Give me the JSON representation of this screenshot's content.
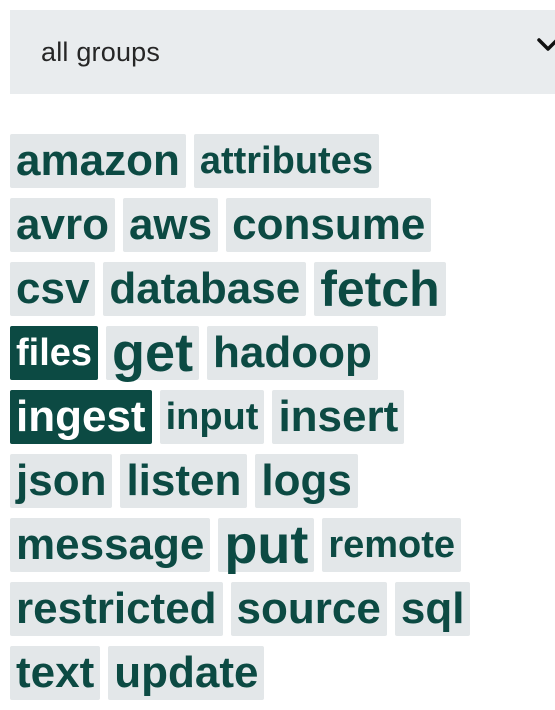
{
  "filter": {
    "selected_group": "all groups"
  },
  "icons": {
    "dropdown": "chevron-down-icon"
  },
  "colors": {
    "tag_background": "#e3e7e9",
    "tag_text": "#0c4a43",
    "selected_background": "#0c4a43",
    "selected_text": "#ffffff",
    "select_background": "#e9ecee"
  },
  "tags": [
    {
      "label": "amazon",
      "selected": false
    },
    {
      "label": "attributes",
      "selected": false
    },
    {
      "label": "avro",
      "selected": false
    },
    {
      "label": "aws",
      "selected": false
    },
    {
      "label": "consume",
      "selected": false
    },
    {
      "label": "csv",
      "selected": false
    },
    {
      "label": "database",
      "selected": false
    },
    {
      "label": "fetch",
      "selected": false
    },
    {
      "label": "files",
      "selected": true
    },
    {
      "label": "get",
      "selected": false
    },
    {
      "label": "hadoop",
      "selected": false
    },
    {
      "label": "ingest",
      "selected": true
    },
    {
      "label": "input",
      "selected": false
    },
    {
      "label": "insert",
      "selected": false
    },
    {
      "label": "json",
      "selected": false
    },
    {
      "label": "listen",
      "selected": false
    },
    {
      "label": "logs",
      "selected": false
    },
    {
      "label": "message",
      "selected": false
    },
    {
      "label": "put",
      "selected": false
    },
    {
      "label": "remote",
      "selected": false
    },
    {
      "label": "restricted",
      "selected": false
    },
    {
      "label": "source",
      "selected": false
    },
    {
      "label": "sql",
      "selected": false
    },
    {
      "label": "text",
      "selected": false
    },
    {
      "label": "update",
      "selected": false
    }
  ]
}
